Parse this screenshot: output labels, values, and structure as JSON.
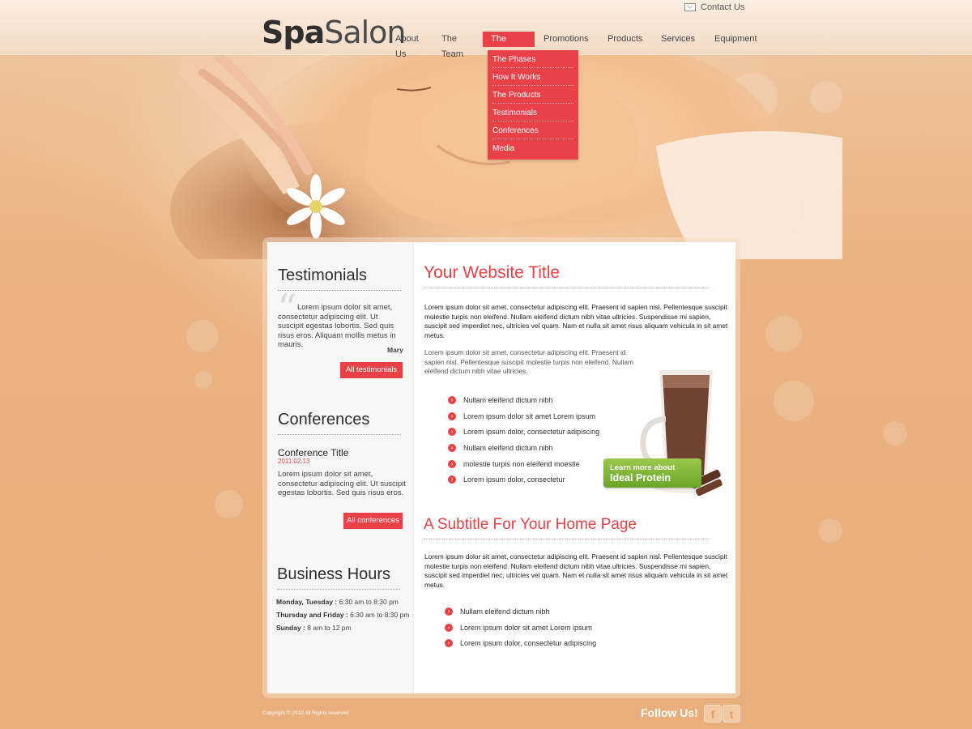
{
  "header": {
    "logo": {
      "part1": "Spa",
      "part2": "Salon"
    },
    "contact_label": "Contact Us"
  },
  "nav": {
    "items": [
      {
        "label": "About Us"
      },
      {
        "label": "The Team"
      },
      {
        "label": "The Method",
        "active": true
      },
      {
        "label": "Promotions"
      },
      {
        "label": "Products"
      },
      {
        "label": "Services"
      },
      {
        "label": "Equipment"
      }
    ],
    "dropdown": [
      {
        "label": "The Phases"
      },
      {
        "label": "How It Works"
      },
      {
        "label": "The Products"
      },
      {
        "label": "Testimonials"
      },
      {
        "label": "Conferences"
      },
      {
        "label": "Media"
      }
    ]
  },
  "sidebar": {
    "testimonials": {
      "heading": "Testimonials",
      "text": "Lorem ipsum dolor sit amet, consectetur adipiscing elit. Ut suscipit egestas lobortis. Sed quis risus eros. Aliquam mollis metus in mauris.",
      "author": "Mary",
      "button": "All testimonials"
    },
    "conferences": {
      "heading": "Conferences",
      "title": "Conference Title",
      "date": "2011.02.13",
      "text": "Lorem ipsum dolor sit amet, consectetur adipiscing elit. Ut suscipit egestas lobortis. Sed quis risus eros.",
      "button": "All conferences"
    },
    "hours": {
      "heading": "Business Hours",
      "rows": [
        {
          "days": "Monday, Tuesday :",
          "time": "6:30 am to 8:30 pm"
        },
        {
          "days": "Thursday and Friday :",
          "time": "6:30 am to 8:30 pm"
        },
        {
          "days": "Sunday :",
          "time": "8 am to 12 pm"
        }
      ]
    }
  },
  "main": {
    "title": "Your Website Title",
    "p1": "Lorem ipsum dolor sit amet, consectetur adipiscing elit. Praesent id sapien nisl. Pellentesque suscipit molestie turpis non eleifend. Nullam eleifend dictum nibh vitae ultricies. Suspendisse mi sapien, suscipit sed imperdiet nec, ultricies vel quam. Nam et nulla sit amet risus aliquam vehicula in sit amet metus.",
    "p2": "Lorem ipsum dolor sit amet, consectetur adipiscing elit. Praesent id sapien nisl. Pellentesque suscipit molestie turpis non eleifend. Nullam eleifend dictum nibh vitae ultricies.",
    "list1": [
      "Nullam eleifend dictum nibh",
      "Lorem ipsum dolor sit amet Lorem ipsum",
      "Lorem ipsum dolor, consectetur adipiscing",
      "Nullam eleifend dictum nibh",
      "molestie turpis non eleifend moestie",
      "Lorem ipsum dolor, consectetur"
    ],
    "promo": {
      "line1": "Learn more about",
      "line2": "Ideal Protein"
    },
    "subtitle": "A Subtitle For Your Home Page",
    "p3": "Lorem ipsum dolor sit amet, consectetur adipiscing elit. Praesent id sapien nisl. Pellentesque suscipit molestie turpis non eleifend. Nullam eleifend dictum nibh vitae ultricies. Suspendisse mi sapien, suscipit sed imperdiet nec, ultricies vel quam. Nam et nulla sit amet risus aliquam vehicula in sit amet metus.",
    "list2": [
      "Nullam eleifend dictum nibh",
      "Lorem ipsum dolor sit amet Lorem ipsum",
      "Lorem ipsum dolor, consectetur adipiscing"
    ]
  },
  "footer": {
    "copyright": "Copyright © 2010 All Rights reserved",
    "follow": "Follow Us!",
    "facebook_glyph": "f",
    "twitter_glyph": "t"
  },
  "colors": {
    "accent": "#e84148",
    "background": "#e9b07c",
    "promo_green": "#7fb536"
  },
  "icons": [
    "envelope-icon",
    "bullet-arrow-icon",
    "facebook-icon",
    "twitter-icon",
    "quote-icon"
  ]
}
